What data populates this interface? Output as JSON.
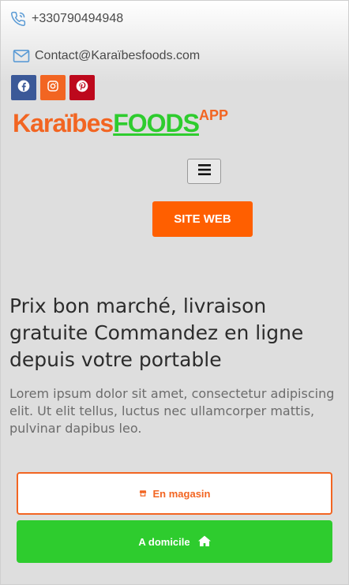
{
  "topbar": {
    "phone": "+330790494948",
    "email": "Contact@Karaïbesfoods.com",
    "phone_icon": "phone-icon",
    "email_icon": "envelope-icon"
  },
  "socials": [
    {
      "name": "facebook",
      "icon": "facebook-icon",
      "color": "#3b5998"
    },
    {
      "name": "instagram",
      "icon": "instagram-icon",
      "color": "#f26522"
    },
    {
      "name": "pinterest",
      "icon": "pinterest-icon",
      "color": "#bd081c"
    }
  ],
  "logo": {
    "part1": "Karaïbes",
    "part2": "FOODS",
    "part3": "APP",
    "colors": {
      "orange": "#f26522",
      "green": "#2ecc2e"
    }
  },
  "nav": {
    "menu_icon": "hamburger-icon"
  },
  "site_button": {
    "label": "SITE WEB",
    "color": "#ff5f00"
  },
  "hero": {
    "headline": "Prix bon marché, livraison gratuite Commandez en ligne depuis votre portable",
    "lead": "Lorem ipsum dolor sit amet, consectetur adipiscing elit. Ut elit tellus, luctus nec ullamcorper mattis, pulvinar dapibus leo."
  },
  "actions": {
    "store_label": "En magasin",
    "store_icon": "store-icon",
    "home_label": "A domicile",
    "home_icon": "home-icon",
    "store_color": "#f26522",
    "home_color": "#2ecc2e"
  }
}
